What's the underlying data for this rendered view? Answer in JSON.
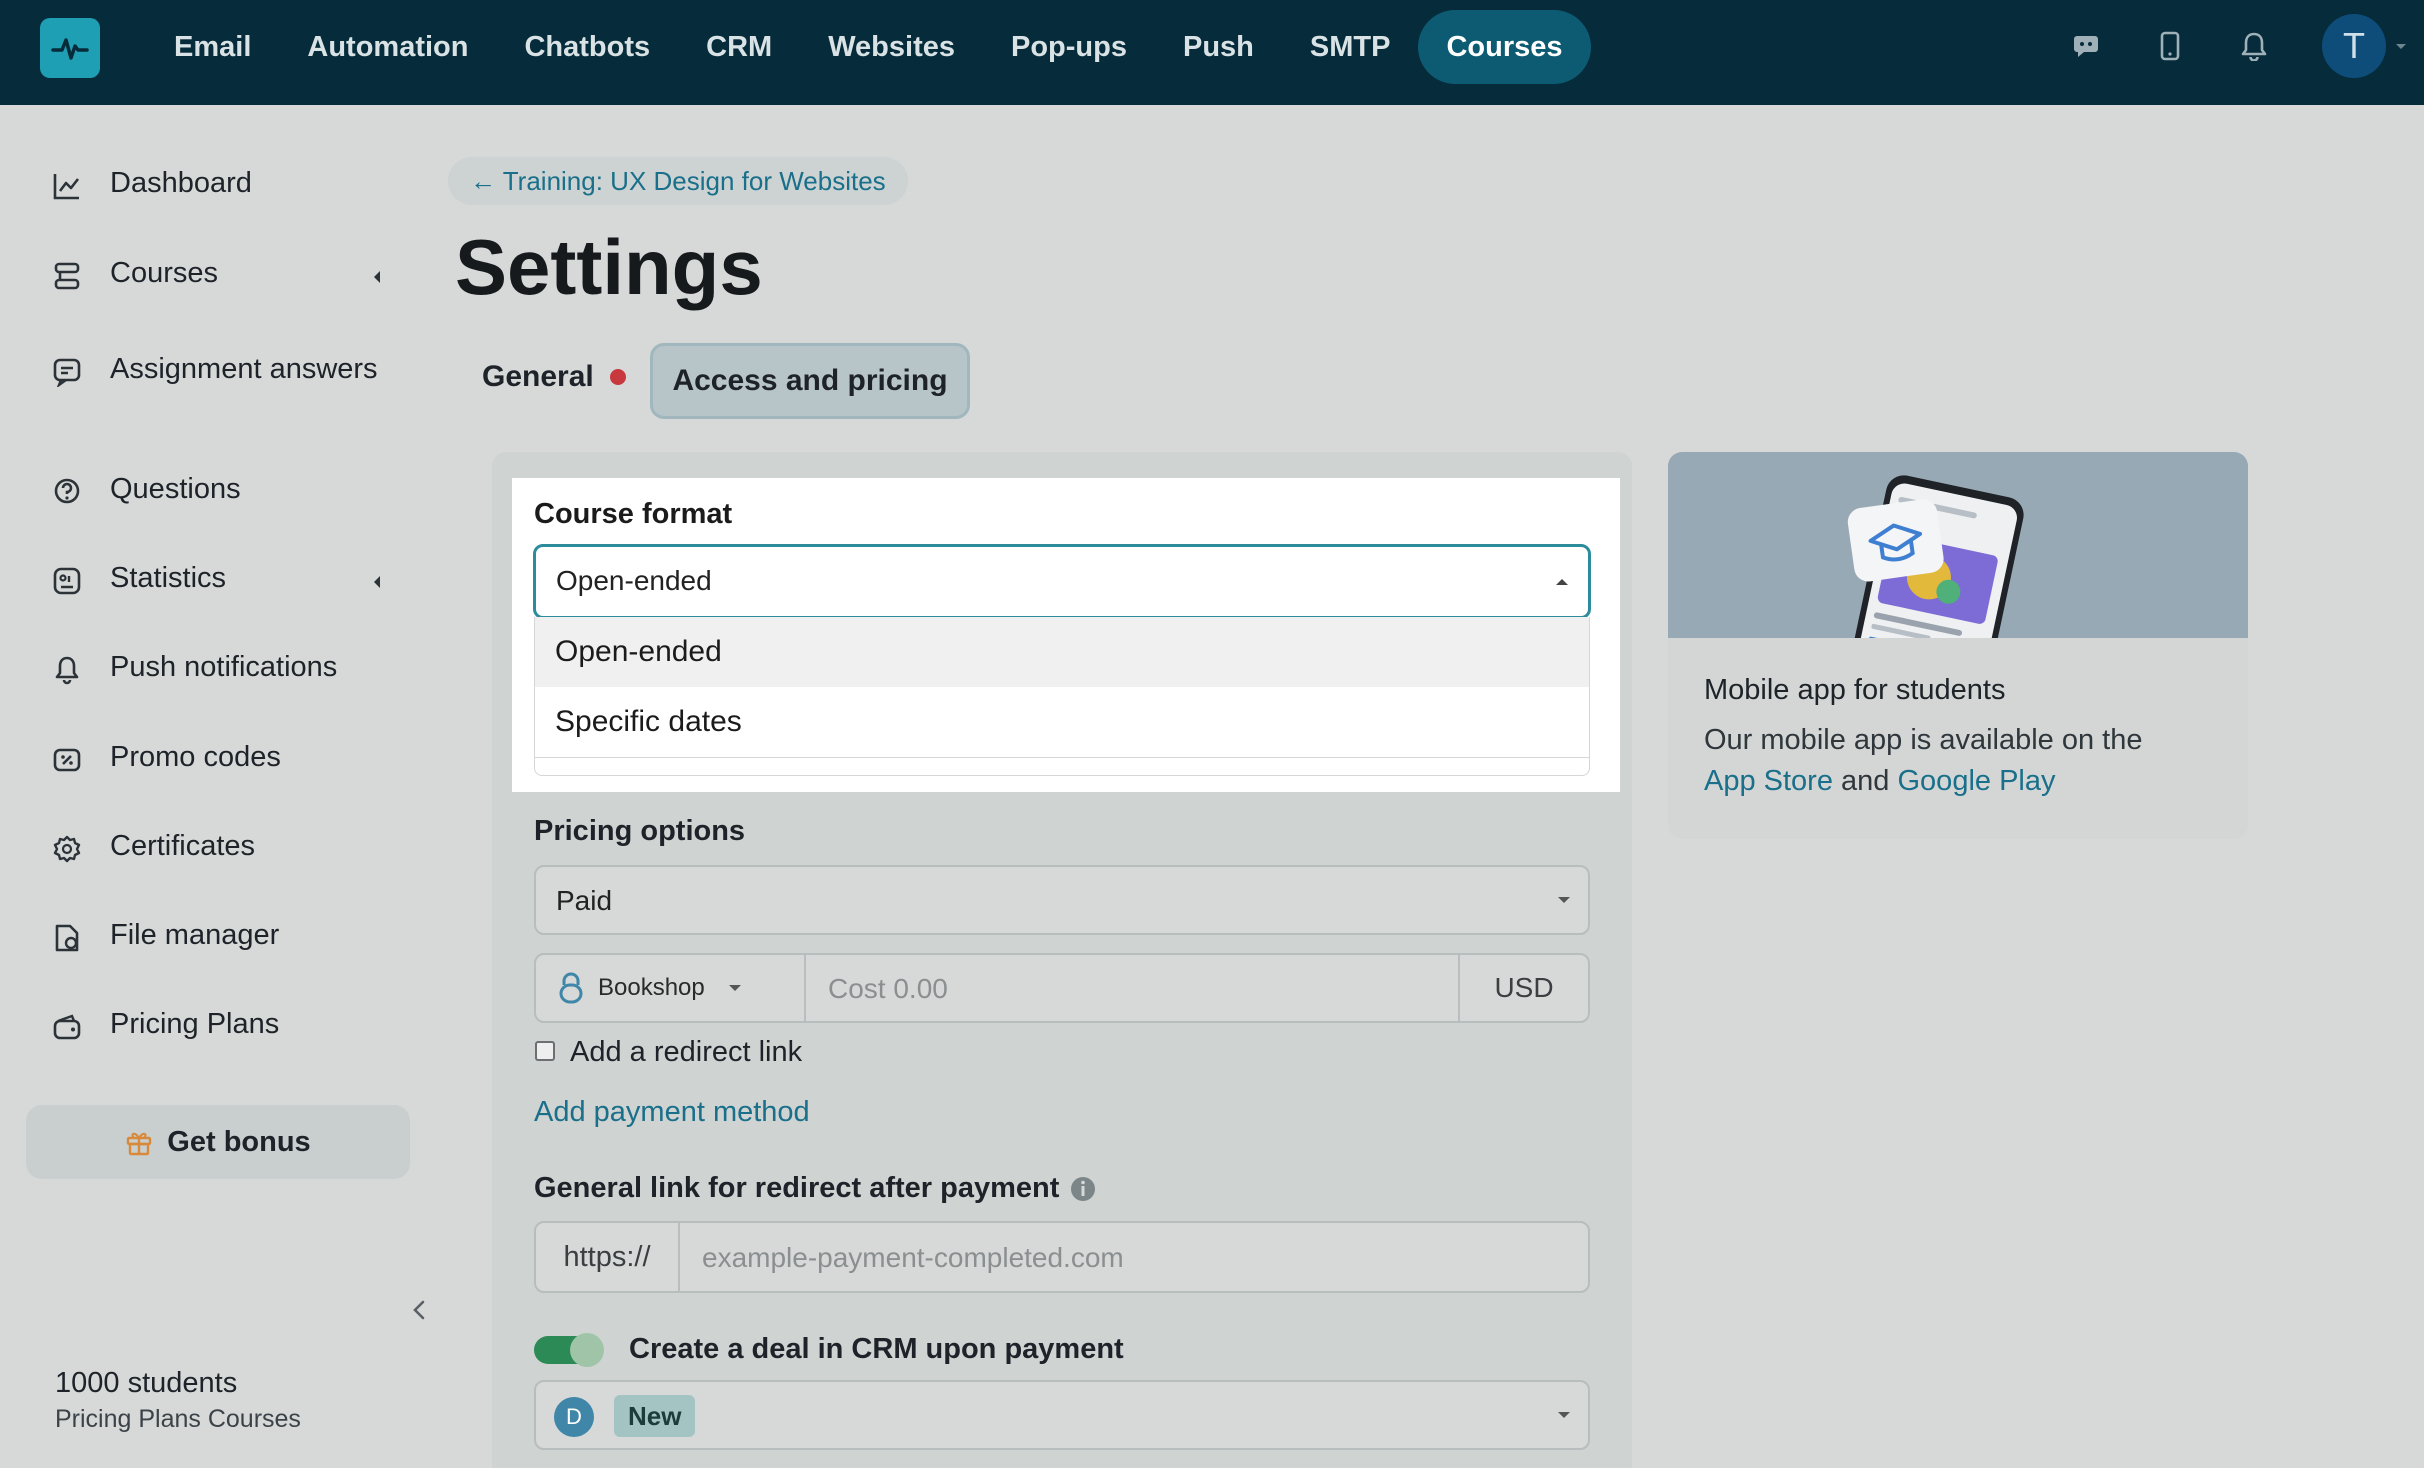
{
  "topbar": {
    "logo_icon": "pulse-logo-icon",
    "nav": [
      {
        "label": "Email",
        "active": false
      },
      {
        "label": "Automation",
        "active": false
      },
      {
        "label": "Chatbots",
        "active": false
      },
      {
        "label": "CRM",
        "active": false
      },
      {
        "label": "Websites",
        "active": false
      },
      {
        "label": "Pop-ups",
        "active": false
      },
      {
        "label": "Push",
        "active": false
      },
      {
        "label": "SMTP",
        "active": false
      },
      {
        "label": "Courses",
        "active": true
      }
    ],
    "icons": [
      "chat-icon",
      "mobile-icon",
      "bell-icon"
    ],
    "avatar_initial": "T"
  },
  "sidebar": {
    "items": [
      {
        "label": "Dashboard",
        "icon": "chart-line-icon"
      },
      {
        "label": "Courses",
        "icon": "layers-icon",
        "expandable": true
      },
      {
        "label": "Assignment answers",
        "icon": "assignment-icon"
      },
      {
        "label": "Questions",
        "icon": "question-icon"
      },
      {
        "label": "Statistics",
        "icon": "statistics-icon",
        "expandable": true
      },
      {
        "label": "Push notifications",
        "icon": "bell-icon"
      },
      {
        "label": "Promo codes",
        "icon": "promo-icon"
      },
      {
        "label": "Certificates",
        "icon": "certificate-icon"
      },
      {
        "label": "File manager",
        "icon": "file-icon"
      },
      {
        "label": "Pricing Plans",
        "icon": "wallet-icon"
      }
    ],
    "bonus_label": "Get bonus",
    "students": "1000 students",
    "plan": "Pricing Plans Courses"
  },
  "main": {
    "back_link": "← Training: UX Design for Websites",
    "title": "Settings",
    "tabs": [
      {
        "label": "General",
        "has_alert": true
      },
      {
        "label": "Access and pricing",
        "active": true
      }
    ],
    "course_format": {
      "label": "Course format",
      "value": "Open-ended",
      "options": [
        "Open-ended",
        "Specific dates"
      ]
    },
    "pricing": {
      "label": "Pricing options",
      "value": "Paid",
      "provider": "Bookshop",
      "cost_placeholder": "Cost 0.00",
      "currency": "USD",
      "redirect_checkbox_label": "Add a redirect link",
      "add_payment_link": "Add payment method"
    },
    "redirect": {
      "label": "General link for redirect after payment",
      "prefix": "https://",
      "placeholder": "example-payment-completed.com"
    },
    "crm": {
      "toggle_label": "Create a deal in CRM upon payment",
      "toggle_on": true,
      "avatar_initial": "D",
      "stage": "New"
    }
  },
  "promo": {
    "title": "Mobile app for students",
    "text": "Our mobile app is available on the",
    "app_store": "App Store",
    "and": "and",
    "google_play": "Google Play"
  },
  "colors": {
    "topbar": "#062b3a",
    "accent": "#1a6f8a",
    "active_nav": "#0d5b73",
    "alert_dot": "#c8393e",
    "toggle_on": "#2b8a56"
  }
}
